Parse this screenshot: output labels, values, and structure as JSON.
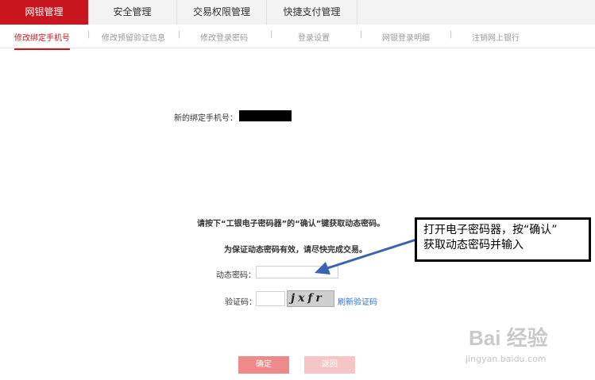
{
  "tabs": [
    {
      "label": "网银管理",
      "active": true
    },
    {
      "label": "安全管理",
      "active": false
    },
    {
      "label": "交易权限管理",
      "active": false
    },
    {
      "label": "快捷支付管理",
      "active": false
    }
  ],
  "subnav": [
    {
      "label": "修改绑定手机号",
      "active": true
    },
    {
      "label": "修改预留验证信息",
      "active": false
    },
    {
      "label": "修改登录密码",
      "active": false
    },
    {
      "label": "登录设置",
      "active": false
    },
    {
      "label": "网银登录明细",
      "active": false
    },
    {
      "label": "注销网上银行",
      "active": false
    }
  ],
  "subnav_separator": "|",
  "form": {
    "new_phone_label": "新的绑定手机号：",
    "instruction_1": "请按下“工银电子密码器”的“确认”键获取动态密码。",
    "instruction_2": "为保证动态密码有效，请尽快完成交易。",
    "dynamic_password_label": "动态密码：",
    "dynamic_password_value": "",
    "captcha_label": "验证码：",
    "captcha_value": "",
    "captcha_image_text": "jxfr",
    "refresh_captcha": "刷新验证码"
  },
  "buttons": {
    "confirm": "确定",
    "back": "返回"
  },
  "annotation": {
    "line1": "打开电子密码器，按“确认”",
    "line2": "获取动态密码并输入"
  },
  "watermark": {
    "main": "Bai 经验",
    "sub": "jingyan.baidu.com"
  },
  "colors": {
    "brand": "#c9161e",
    "arrow": "#3a63b0",
    "link": "#2b73c8"
  }
}
